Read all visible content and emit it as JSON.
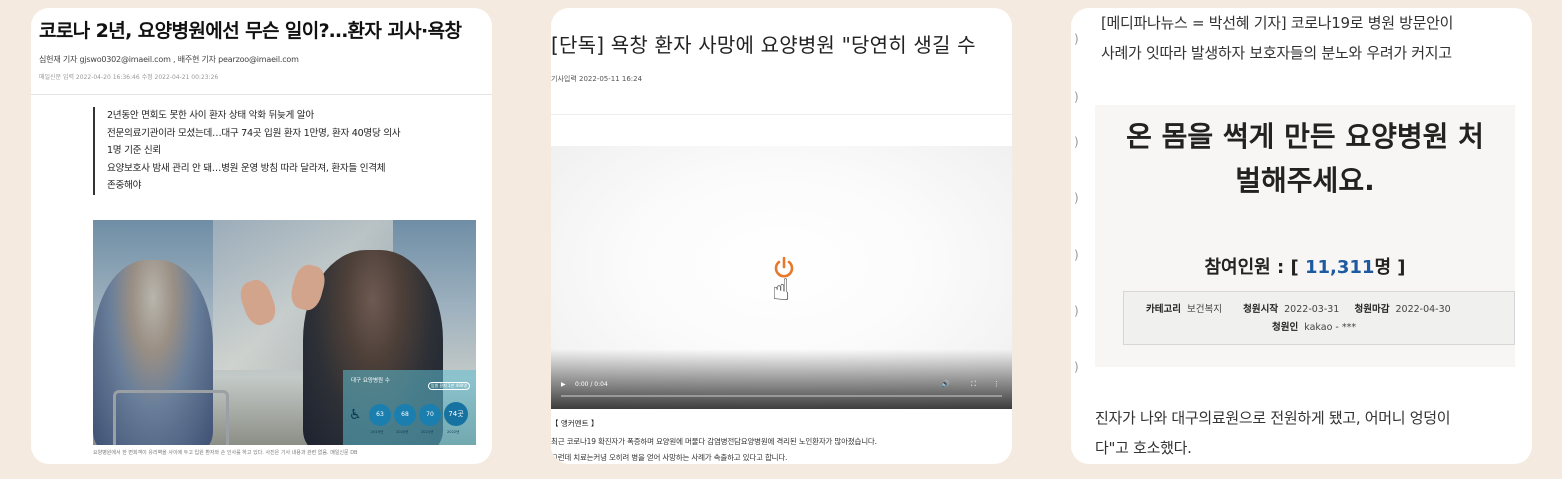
{
  "article1": {
    "title": "코로나 2년, 요양병원에선 무슨 일이?…환자 괴사·욕창",
    "byline": "심헌재 기자 gjswo0302@imaeil.com , 배주현 기자 pearzoo@imaeil.com",
    "date": "매일신문 입력 2022-04-20 16:36:46 수정 2022-04-21 00:23:26",
    "summary": [
      "2년동안 면회도 못한 사이 환자 상태 악화 뒤늦게 알아",
      "전문의료기관이라 모셨는데…대구 74곳 입원 환자 1만명, 환자 40명당 의사",
      "1명 기준 신뢰",
      "요양보호사 밤새 관리 안 돼…병원 운영 방침 따라 달라져, 환자들 인격체",
      "존중해야"
    ],
    "infographic": {
      "heading": "대구 요양병원 수",
      "badge": "입원 환자 1만 490명",
      "values": [
        "63",
        "68",
        "70",
        "74곳"
      ],
      "years": [
        "2019년",
        "2020년",
        "2021년",
        "2022년"
      ]
    },
    "caption": "요양병원에서 한 면회객이 유리벽을 사이에 두고 입원 환자와 손 인사를 하고 있다. 사진은 기사 내용과 관련 없음. 매일신문 DB"
  },
  "article2": {
    "title": "[단독] 욕창 환자 사망에 요양병원 \"당연히 생길 수",
    "date": "기사입력 2022-05-11 16:24",
    "video": {
      "time": "0:00 / 0:04",
      "play_progress": 0
    },
    "anchor_label": "【 앵커멘트 】",
    "body": [
      "최근 코로나19 확진자가 폭증하며 요양원에 머물다 감염병전담요양병원에 격리된 노인환자가 많아졌습니다.",
      "그런데 치료는커녕 오히려 병을 얻어 사망하는 사례가 속출하고 있다고 합니다."
    ]
  },
  "article3": {
    "top_lines": [
      "[메디파나뉴스 = 박선혜 기자] 코로나19로 병원 방문안이 ",
      "사례가 잇따라 발생하자 보호자들의 분노와 우려가 커지고"
    ],
    "petition": {
      "title_line1": "온 몸을 썩게 만든 요양병원 처",
      "title_line2": "벌해주세요.",
      "count_label": "참여인원 : [ ",
      "count_value": "11,311",
      "count_unit": "명 ]",
      "category_label": "카테고리",
      "category_value": "보건복지",
      "start_label": "청원시작",
      "start_value": "2022-03-31",
      "end_label": "청원마감",
      "end_value": "2022-04-30",
      "petitioner_label": "청원인",
      "petitioner_value": "kakao - ***"
    },
    "bottom_lines": [
      "진자가 나와 대구의료원으로 전원하게 됐고, 어머니 엉덩이",
      "다\"고 호소했다."
    ]
  },
  "colors": {
    "background": "#f5eadf",
    "petition_count": "#1e5aa0",
    "power_icon": "#e8782b",
    "infographic": "#1a7fae"
  }
}
